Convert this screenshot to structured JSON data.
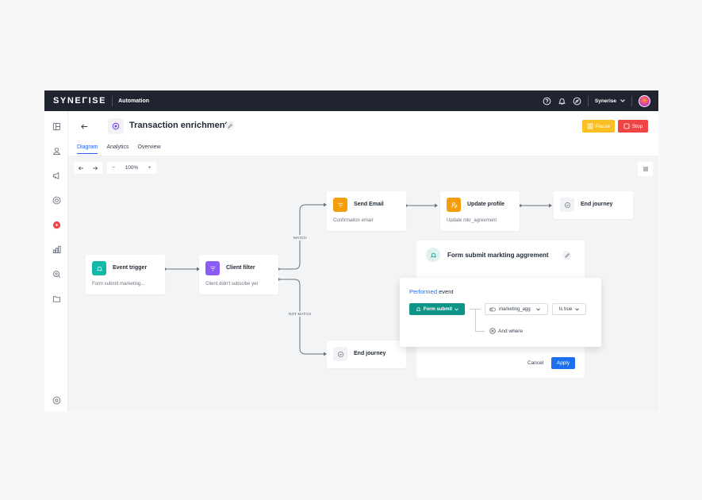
{
  "topbar": {
    "logo": "SYNEΓISE",
    "app_name": "Automation",
    "workspace": "Synerise",
    "icons": [
      "help-icon",
      "bell-icon",
      "compass-icon",
      "chevron-down-icon",
      "avatar"
    ]
  },
  "sidebar": {
    "items": [
      "dashboard-icon",
      "profiles-icon",
      "campaigns-icon",
      "analytics-icon",
      "automation-icon",
      "reports-icon",
      "search-data-icon",
      "folder-icon",
      "settings-icon"
    ],
    "active_color": "#ef4444"
  },
  "header": {
    "title": "Transaction enrichment",
    "pause_label": "Pause",
    "stop_label": "Stop",
    "tabs": [
      {
        "label": "Diagram",
        "active": true
      },
      {
        "label": "Analytics",
        "active": false
      },
      {
        "label": "Overview",
        "active": false
      }
    ]
  },
  "toolbar": {
    "zoom_minus": "−",
    "zoom_level": "100%",
    "zoom_plus": "+"
  },
  "nodes": {
    "event_trigger": {
      "title": "Event trigger",
      "subtitle": "Form submit marketing...",
      "color": "#14b8a6"
    },
    "client_filter": {
      "title": "Client filter",
      "subtitle": "Client didn't subscibe yet",
      "color": "#8b5cf6"
    },
    "send_email": {
      "title": "Send Email",
      "subtitle": "Confirmation email",
      "color": "#f59e0b"
    },
    "update_profile": {
      "title": "Update profile",
      "subtitle": "Update mkr_agreement",
      "color": "#f59e0b"
    },
    "end_journey_top": {
      "title": "End journey"
    },
    "end_journey_bottom": {
      "title": "End journey"
    }
  },
  "connectors": {
    "match_label": "MATCH",
    "not_match_label": "NOT MATCH"
  },
  "settings_panel": {
    "title": "Form submit markting aggrement",
    "cancel_label": "Cancel",
    "apply_label": "Apply"
  },
  "filter_popup": {
    "performed": "Performed",
    "event_word": "event",
    "event_button": "Form submit",
    "param": "marketing_agg",
    "operator": "Is true",
    "and_where": "And where"
  },
  "colors": {
    "topbar_bg": "#1f2430",
    "primary_blue": "#1d6ff2",
    "pause_yellow": "#fbbf24",
    "stop_red": "#ef4444",
    "teal": "#0f9488"
  }
}
